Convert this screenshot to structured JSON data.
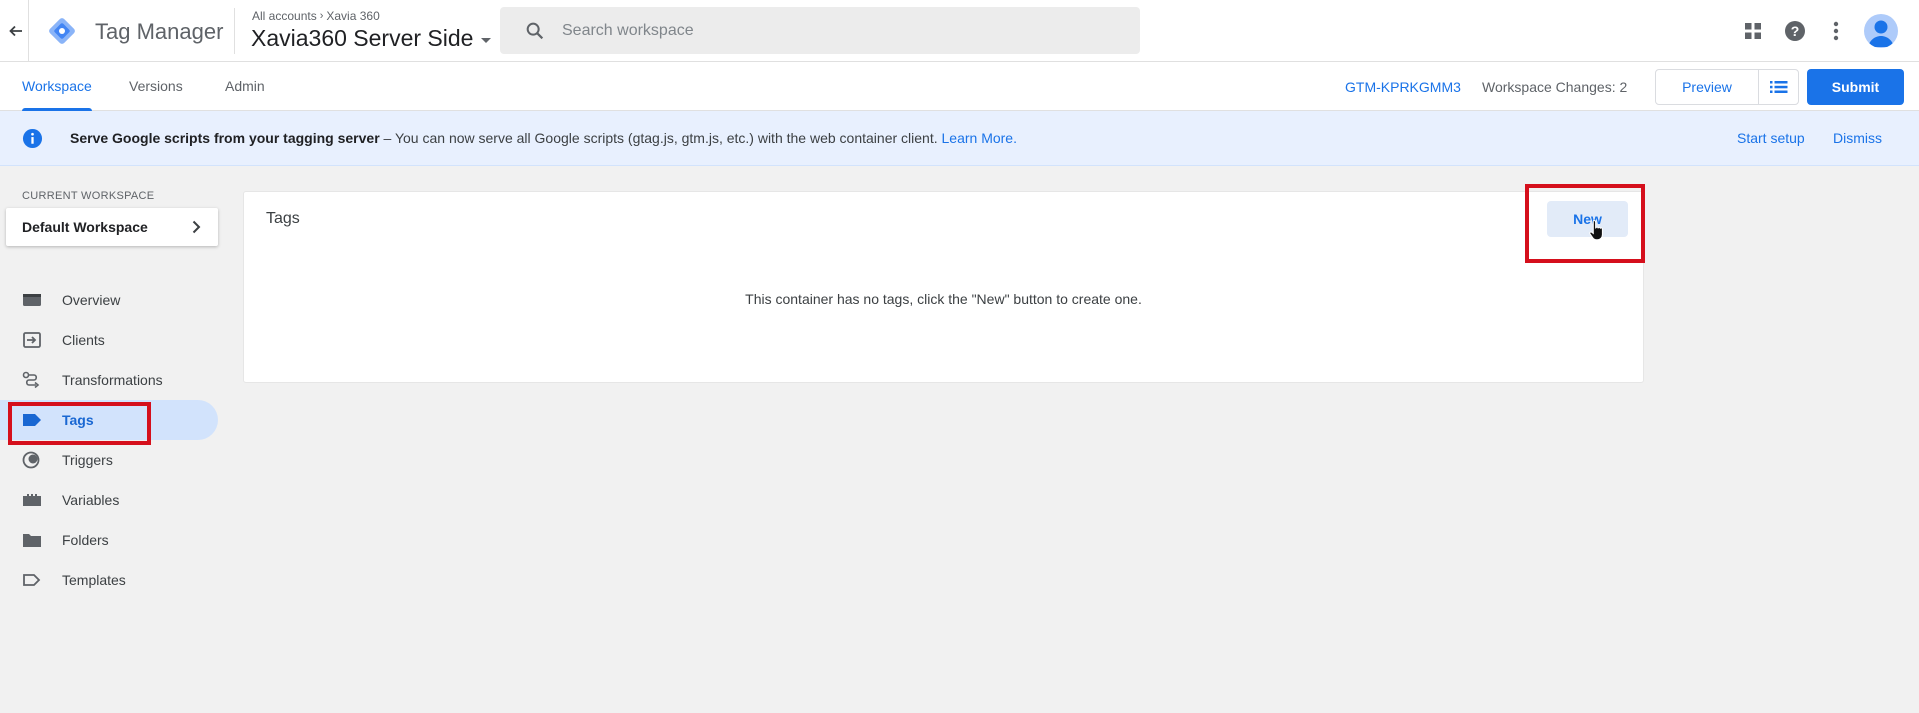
{
  "header": {
    "app_title": "Tag Manager",
    "breadcrumb": {
      "account": "All accounts",
      "parent": "Xavia 360"
    },
    "container_name": "Xavia360 Server Side",
    "search_placeholder": "Search workspace"
  },
  "tabs": [
    {
      "label": "Workspace",
      "active": true
    },
    {
      "label": "Versions",
      "active": false
    },
    {
      "label": "Admin",
      "active": false
    }
  ],
  "toolbar": {
    "container_id": "GTM-KPRKGMM3",
    "workspace_changes": "Workspace Changes: 2",
    "preview_label": "Preview",
    "submit_label": "Submit"
  },
  "banner": {
    "bold": "Serve Google scripts from your tagging server",
    "message": " – You can now serve all Google scripts (gtag.js, gtm.js, etc.) with the web container client. ",
    "link": "Learn More.",
    "start_setup": "Start setup",
    "dismiss": "Dismiss"
  },
  "sidebar": {
    "current_workspace_label": "CURRENT WORKSPACE",
    "workspace_name": "Default Workspace",
    "items": [
      {
        "label": "Overview",
        "icon": "overview-icon"
      },
      {
        "label": "Clients",
        "icon": "clients-icon"
      },
      {
        "label": "Transformations",
        "icon": "transformations-icon"
      },
      {
        "label": "Tags",
        "icon": "tag-icon",
        "active": true
      },
      {
        "label": "Triggers",
        "icon": "triggers-icon"
      },
      {
        "label": "Variables",
        "icon": "variables-icon"
      },
      {
        "label": "Folders",
        "icon": "folder-icon"
      },
      {
        "label": "Templates",
        "icon": "templates-icon"
      }
    ]
  },
  "main": {
    "card_title": "Tags",
    "new_button": "New",
    "empty_message": "This container has no tags, click the \"New\" button to create one."
  },
  "colors": {
    "accent": "#1a73e8",
    "banner_bg": "#e8f0fe",
    "highlight": "#d50f1c"
  }
}
